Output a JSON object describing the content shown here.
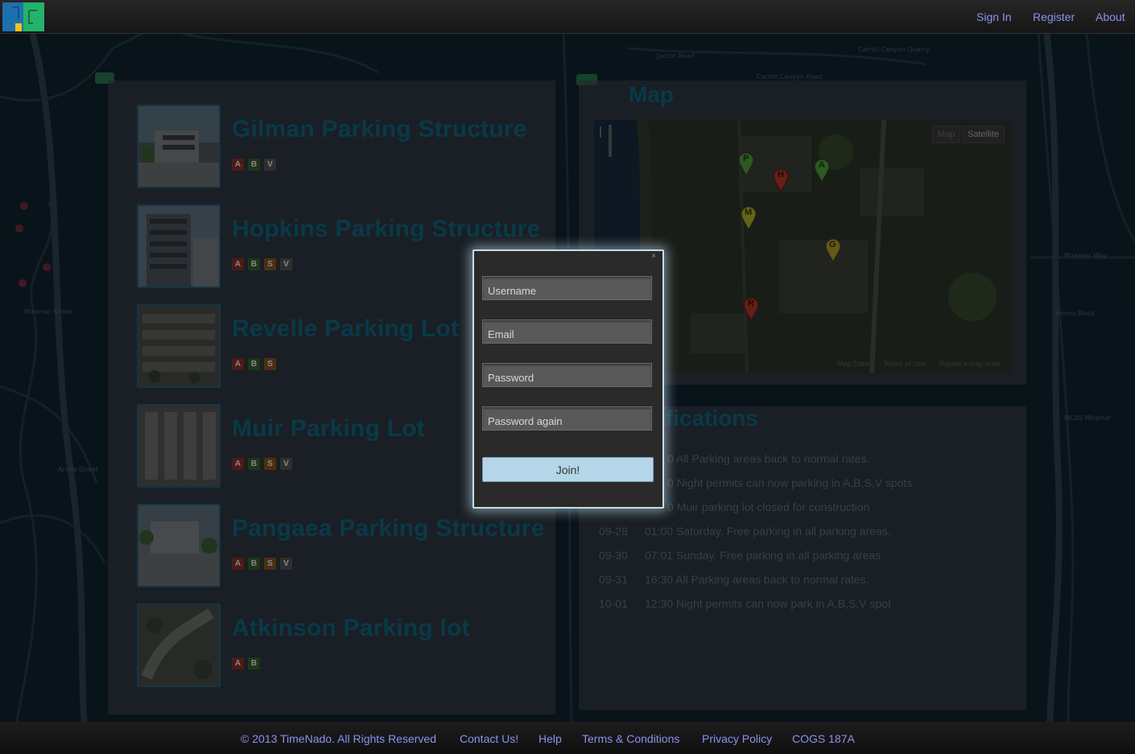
{
  "nav": {
    "links": [
      "Sign In",
      "Register",
      "About"
    ]
  },
  "lots": [
    {
      "name": "Gilman Parking Structure",
      "permits": [
        "A",
        "B",
        "V"
      ],
      "photo": "building-photo"
    },
    {
      "name": "Hopkins Parking Structure",
      "permits": [
        "A",
        "B",
        "S",
        "V"
      ],
      "photo": "building-photo"
    },
    {
      "name": "Revelle Parking Lot",
      "permits": [
        "A",
        "B",
        "S"
      ],
      "photo": "aerial-photo"
    },
    {
      "name": "Muir Parking Lot",
      "permits": [
        "A",
        "B",
        "S",
        "V"
      ],
      "photo": "aerial-photo"
    },
    {
      "name": "Pangaea Parking Structure",
      "permits": [
        "A",
        "B",
        "S",
        "V"
      ],
      "photo": "building-photo"
    },
    {
      "name": "Atkinson Parking lot",
      "permits": [
        "A",
        "B"
      ],
      "photo": "aerial-photo"
    }
  ],
  "map": {
    "title": "Map",
    "type_buttons": [
      "Map",
      "Satellite"
    ],
    "selected_type": "Satellite",
    "markers": [
      {
        "label": "P",
        "color": "#3f7a2b"
      },
      {
        "label": "H",
        "color": "#8b2b22"
      },
      {
        "label": "A",
        "color": "#3f7a2b"
      },
      {
        "label": "M",
        "color": "#8a8a25"
      },
      {
        "label": "G",
        "color": "#8a7a25"
      },
      {
        "label": "R",
        "color": "#8b2b22"
      }
    ],
    "footer": [
      "Map Data",
      "Terms of Use",
      "Report a map error"
    ]
  },
  "notifications": {
    "title": "Notifications",
    "title_visible": "ifications",
    "items": [
      {
        "date": "",
        "time": "0",
        "text": "All Parking areas back to normal rates."
      },
      {
        "date": "",
        "time": "0",
        "text": "Night permits can now parking in A,B,S,V spots"
      },
      {
        "date": "",
        "time": "0",
        "text": "Muir parking lot closed for construction"
      },
      {
        "date": "09-28",
        "time": "01:00",
        "text": "Saturday. Free parking in all parking areas."
      },
      {
        "date": "09-30",
        "time": "07:01",
        "text": "Sunday. Free parking in all parking areas"
      },
      {
        "date": "09-31",
        "time": "16:30",
        "text": "All Parking areas back to normal rates."
      },
      {
        "date": "10-01",
        "time": "12:30",
        "text": "Night permits can now park in A,B,S,V spot"
      }
    ]
  },
  "modal": {
    "close_icon": "×",
    "username_placeholder": "Username",
    "email_placeholder": "Email",
    "password_placeholder": "Password",
    "password_again_placeholder": "Password again",
    "join_label": "Join!"
  },
  "footer": {
    "copyright": "© 2013 TimeNado. All Rights Reserved",
    "links": [
      "Contact Us!",
      "Help",
      "Terms & Conditions",
      "Privacy Policy",
      "COGS 187A"
    ]
  },
  "colors": {
    "accent": "#8e90f0",
    "heading": "#0d4f66",
    "modal_glow": "#c7dde8",
    "join_button": "#b5d5e8"
  }
}
